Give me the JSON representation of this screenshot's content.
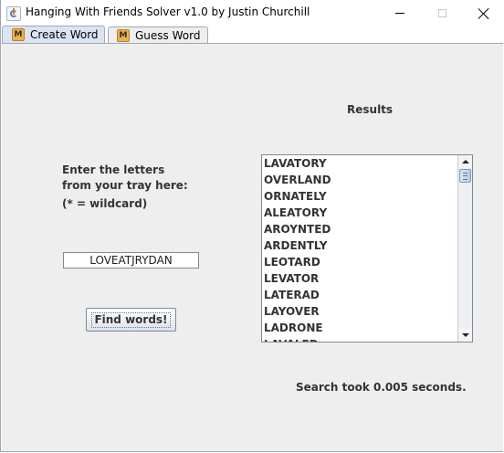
{
  "window": {
    "title": "Hanging With Friends Solver v1.0 by Justin Churchill"
  },
  "tabs": [
    {
      "label": "Create Word",
      "icon": "app-tab-icon",
      "selected": true
    },
    {
      "label": "Guess Word",
      "icon": "app-tab-icon",
      "selected": false
    }
  ],
  "create_word": {
    "instructions_line1": "Enter the letters",
    "instructions_line2": "from your tray here:",
    "wildcard_note": "(* = wildcard)",
    "letters_value": "LOVEATJRYDAN",
    "find_button_label": "Find words!",
    "results_heading": "Results",
    "results": [
      "LAVATORY",
      "OVERLAND",
      "ORNATELY",
      "ALEATORY",
      "AROYNTED",
      "ARDENTLY",
      "LEOTARD",
      "LEVATOR",
      "LATERAD",
      "LAYOVER",
      "LADRONE",
      "LAVALED"
    ],
    "search_status": "Search took 0.005 seconds."
  },
  "colors": {
    "panel_background": "#eeeeee",
    "selected_tab": "#dbe5f2",
    "label_text": "#333333"
  }
}
